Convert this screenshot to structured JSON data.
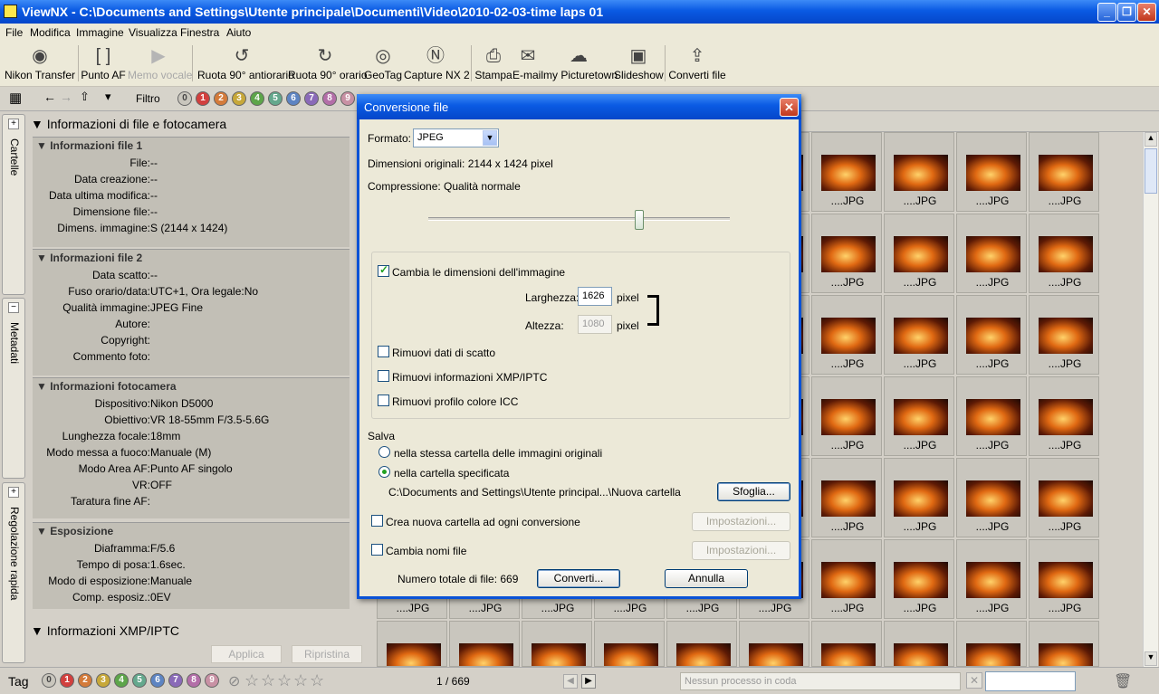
{
  "window": {
    "title": "ViewNX - C:\\Documents and Settings\\Utente principale\\Documenti\\Video\\2010-02-03-time laps 01"
  },
  "menu": [
    "File",
    "Modifica",
    "Immagine",
    "Visualizza",
    "Finestra",
    "Aiuto"
  ],
  "toolbar": [
    {
      "label": "Nikon Transfer",
      "icon": "camera-icon"
    },
    {
      "label": "Punto AF",
      "icon": "af-point-icon"
    },
    {
      "label": "Memo vocale",
      "icon": "voice-memo-icon"
    },
    {
      "label": "Ruota 90° antiorario",
      "icon": "rotate-ccw-icon"
    },
    {
      "label": "Ruota 90° orario",
      "icon": "rotate-cw-icon"
    },
    {
      "label": "GeoTag",
      "icon": "globe-icon"
    },
    {
      "label": "Capture NX 2",
      "icon": "capture-nx-icon"
    },
    {
      "label": "Stampa",
      "icon": "printer-icon"
    },
    {
      "label": "E-mail",
      "icon": "mail-icon"
    },
    {
      "label": "my Picturetown",
      "icon": "picturetown-icon"
    },
    {
      "label": "Slideshow",
      "icon": "slideshow-icon"
    },
    {
      "label": "Converti file",
      "icon": "convert-icon"
    }
  ],
  "filter": {
    "label": "Filtro",
    "ratings": [
      "0",
      "1",
      "2",
      "3",
      "4",
      "5",
      "6",
      "7",
      "8",
      "9"
    ]
  },
  "sidebar_tabs": [
    "Cartelle",
    "Metadati",
    "Regolazione rapida"
  ],
  "left_panel": {
    "header": "Informazioni di file e fotocamera",
    "groups": [
      {
        "title": "Informazioni file 1",
        "rows": [
          {
            "k": "File:",
            "v": "--"
          },
          {
            "k": "Data creazione:",
            "v": "--"
          },
          {
            "k": "Data ultima modifica:",
            "v": "--"
          },
          {
            "k": "Dimensione file:",
            "v": "--"
          },
          {
            "k": "Dimens. immagine:",
            "v": "S (2144 x 1424)"
          }
        ]
      },
      {
        "title": "Informazioni file 2",
        "rows": [
          {
            "k": "Data scatto:",
            "v": "--"
          },
          {
            "k": "Fuso orario/data:",
            "v": "UTC+1, Ora legale:No"
          },
          {
            "k": "Qualità immagine:",
            "v": "JPEG Fine"
          },
          {
            "k": "Autore:",
            "v": ""
          },
          {
            "k": "Copyright:",
            "v": ""
          },
          {
            "k": "Commento foto:",
            "v": ""
          }
        ]
      },
      {
        "title": "Informazioni fotocamera",
        "rows": [
          {
            "k": "Dispositivo:",
            "v": "Nikon D5000"
          },
          {
            "k": "Obiettivo:",
            "v": "VR 18-55mm F/3.5-5.6G"
          },
          {
            "k": "Lunghezza focale:",
            "v": "18mm"
          },
          {
            "k": "Modo messa a fuoco:",
            "v": "Manuale (M)"
          },
          {
            "k": "Modo Area AF:",
            "v": "Punto AF singolo"
          },
          {
            "k": "VR:",
            "v": "OFF"
          },
          {
            "k": "Taratura fine AF:",
            "v": ""
          }
        ]
      },
      {
        "title": "Esposizione",
        "rows": [
          {
            "k": "Diaframma:",
            "v": "F/5.6"
          },
          {
            "k": "Tempo di posa:",
            "v": "1.6sec."
          },
          {
            "k": "Modo di esposizione:",
            "v": "Manuale"
          },
          {
            "k": "Comp. esposiz.:",
            "v": "0EV"
          }
        ]
      }
    ],
    "xmp_header": "Informazioni XMP/IPTC",
    "apply": "Applica",
    "reset": "Ripristina"
  },
  "grid": {
    "filename": "....JPG"
  },
  "statusbar": {
    "tag_label": "Tag",
    "counter": "1 / 669",
    "queue_placeholder": "Nessun processo in coda"
  },
  "dialog": {
    "title": "Conversione file",
    "format_label": "Formato:",
    "format_value": "JPEG",
    "original_dims": "Dimensioni originali: 2144 x 1424 pixel",
    "compression": "Compressione: Qualità normale",
    "compression_level": 0.7,
    "resize_label": "Cambia le dimensioni dell'immagine",
    "width_label": "Larghezza:",
    "width_value": "1626",
    "height_label": "Altezza:",
    "height_value": "1080",
    "pixel_unit": "pixel",
    "remove_shoot_data": "Rimuovi dati di scatto",
    "remove_xmp": "Rimuovi informazioni XMP/IPTC",
    "remove_icc": "Rimuovi profilo colore ICC",
    "save_label": "Salva",
    "save_same": "nella stessa cartella delle immagini originali",
    "save_specified": "nella cartella specificata",
    "path": "C:\\Documents and Settings\\Utente principal...\\Nuova cartella",
    "browse": "Sfoglia...",
    "new_folder": "Crea nuova cartella ad ogni conversione",
    "rename": "Cambia nomi file",
    "settings": "Impostazioni...",
    "total": "Numero totale di file: 669",
    "convert": "Converti...",
    "cancel": "Annulla"
  }
}
